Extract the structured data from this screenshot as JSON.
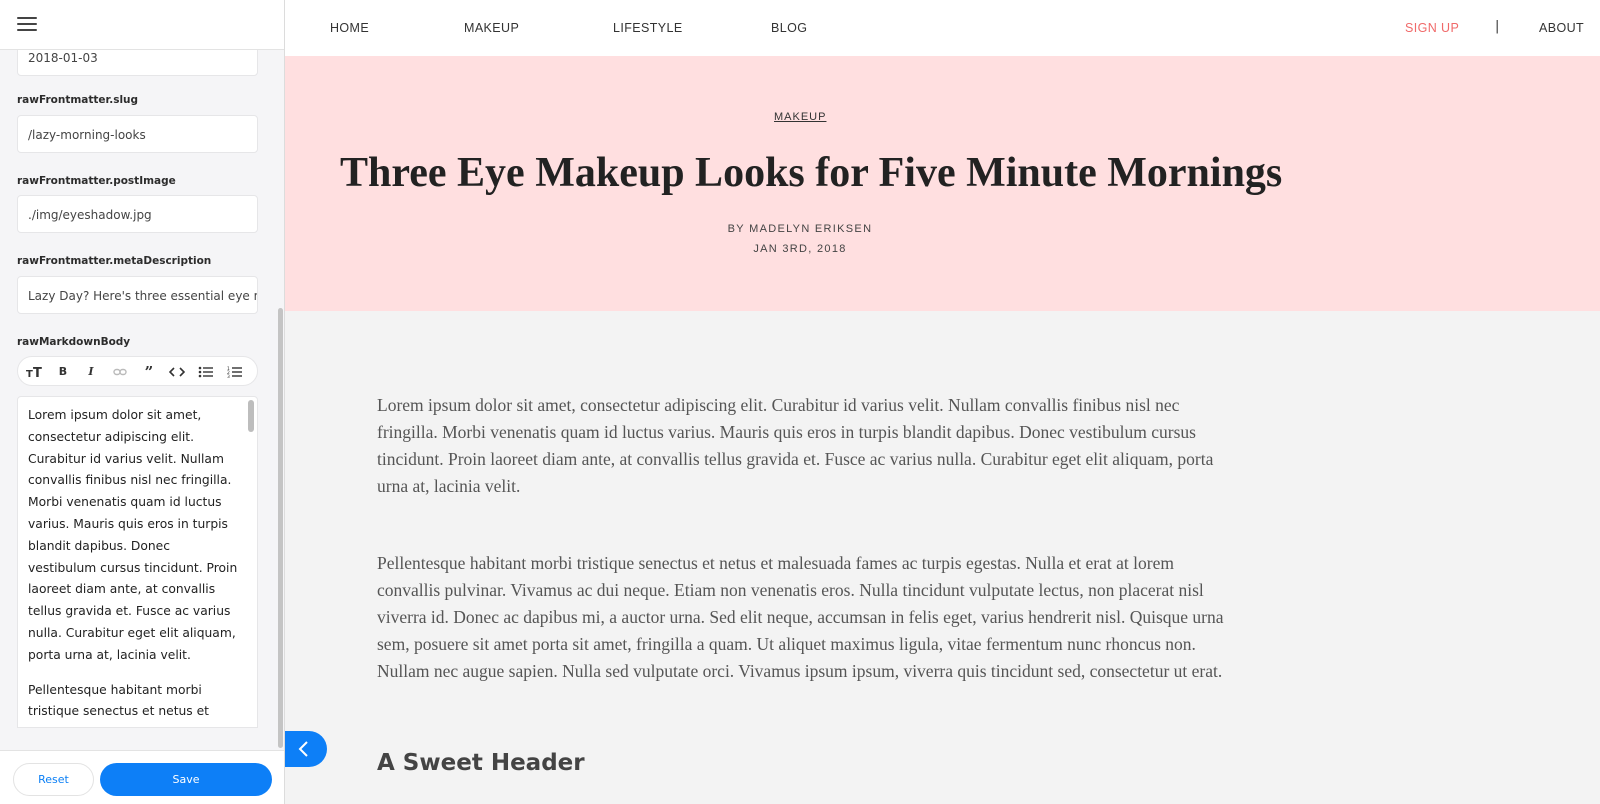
{
  "sidebar": {
    "fields": {
      "date_value": "2018-01-03",
      "slug_label": "rawFrontmatter.slug",
      "slug_value": "/lazy-morning-looks",
      "postimage_label": "rawFrontmatter.postImage",
      "postimage_value": "./img/eyeshadow.jpg",
      "meta_label": "rawFrontmatter.metaDescription",
      "meta_value": "Lazy Day? Here's three essential eye ma",
      "body_label": "rawMarkdownBody"
    },
    "toolbar": {
      "heading": "heading-icon",
      "bold": "bold-icon",
      "italic": "italic-icon",
      "link": "link-icon",
      "quote": "quote-icon",
      "code": "code-icon",
      "bullet_list": "bullet-list-icon",
      "numbered_list": "numbered-list-icon"
    },
    "markdown_body": {
      "p1": "Lorem ipsum dolor sit amet, consectetur adipiscing elit. Curabitur id varius velit. Nullam convallis finibus nisl nec fringilla. Morbi venenatis quam id luctus varius. Mauris quis eros in turpis blandit dapibus. Donec vestibulum cursus tincidunt. Proin laoreet diam ante, at convallis tellus gravida et. Fusce ac varius nulla. Curabitur eget elit aliquam, porta urna at, lacinia velit.",
      "p2": "Pellentesque habitant morbi tristique senectus et netus et"
    },
    "reset_label": "Reset",
    "save_label": "Save",
    "accent_color": "#0d7ff7"
  },
  "nav": {
    "home": "HOME",
    "makeup": "MAKEUP",
    "lifestyle": "LIFESTYLE",
    "blog": "BLOG",
    "signup": "SIGN UP",
    "separator": "|",
    "about": "ABOUT",
    "signup_color": "#f06a6a"
  },
  "hero": {
    "category": "MAKEUP",
    "title": "Three Eye Makeup Looks for Five Minute Mornings",
    "byline": "BY MADELYN ERIKSEN",
    "date": "JAN 3RD, 2018",
    "background": "#ffdfe0"
  },
  "article": {
    "p1": "Lorem ipsum dolor sit amet, consectetur adipiscing elit. Curabitur id varius velit. Nullam convallis finibus nisl nec fringilla. Morbi venenatis quam id luctus varius. Mauris quis eros in turpis blandit dapibus. Donec vestibulum cursus tincidunt. Proin laoreet diam ante, at convallis tellus gravida et. Fusce ac varius nulla. Curabitur eget elit aliquam, porta urna at, lacinia velit.",
    "p2": "Pellentesque habitant morbi tristique senectus et netus et malesuada fames ac turpis egestas. Nulla et erat at lorem convallis pulvinar. Vivamus ac dui neque. Etiam non venenatis eros. Nulla tincidunt vulputate lectus, non placerat nisl viverra id. Donec ac dapibus mi, a auctor urna. Sed elit neque, accumsan in felis eget, varius hendrerit nisl. Quisque urna sem, posuere sit amet porta sit amet, fringilla a quam. Ut aliquet maximus ligula, vitae fermentum nunc rhoncus non. Nullam nec augue sapien. Nulla sed vulputate orci. Vivamus ipsum ipsum, viverra quis tincidunt sed, consectetur ut erat.",
    "h2": "A Sweet Header"
  }
}
